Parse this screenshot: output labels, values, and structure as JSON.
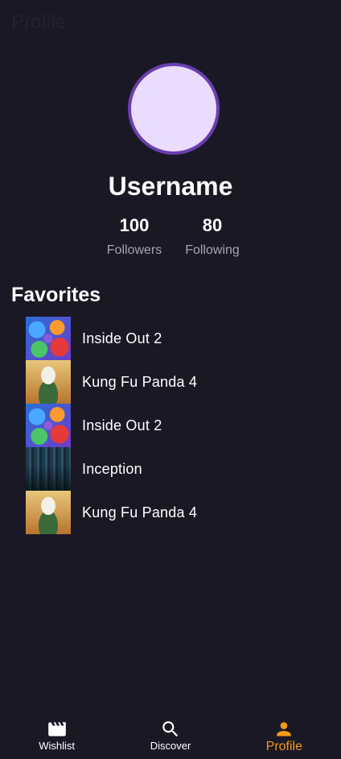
{
  "header": {
    "title": "Profile"
  },
  "profile": {
    "username": "Username",
    "followers_count": "100",
    "followers_label": "Followers",
    "following_count": "80",
    "following_label": "Following",
    "avatar_color": "#eadcfc",
    "avatar_ring_color": "#6a3fb0"
  },
  "favorites": {
    "title": "Favorites",
    "items": [
      {
        "title": "Inside Out 2",
        "poster": "inside-out-2-poster"
      },
      {
        "title": "Kung Fu Panda 4",
        "poster": "kung-fu-panda-4-poster"
      },
      {
        "title": "Inside Out 2",
        "poster": "inside-out-2-poster"
      },
      {
        "title": "Inception",
        "poster": "inception-poster"
      },
      {
        "title": "Kung Fu Panda 4",
        "poster": "kung-fu-panda-4-poster"
      }
    ]
  },
  "bottom_nav": {
    "items": [
      {
        "label": "Wishlist",
        "icon": "clapperboard-icon",
        "active": false
      },
      {
        "label": "Discover",
        "icon": "search-icon",
        "active": false
      },
      {
        "label": "Profile",
        "icon": "person-icon",
        "active": true
      }
    ]
  },
  "colors": {
    "background": "#1b1826",
    "accent": "#f49a16",
    "muted_text": "#a7a3b3"
  }
}
